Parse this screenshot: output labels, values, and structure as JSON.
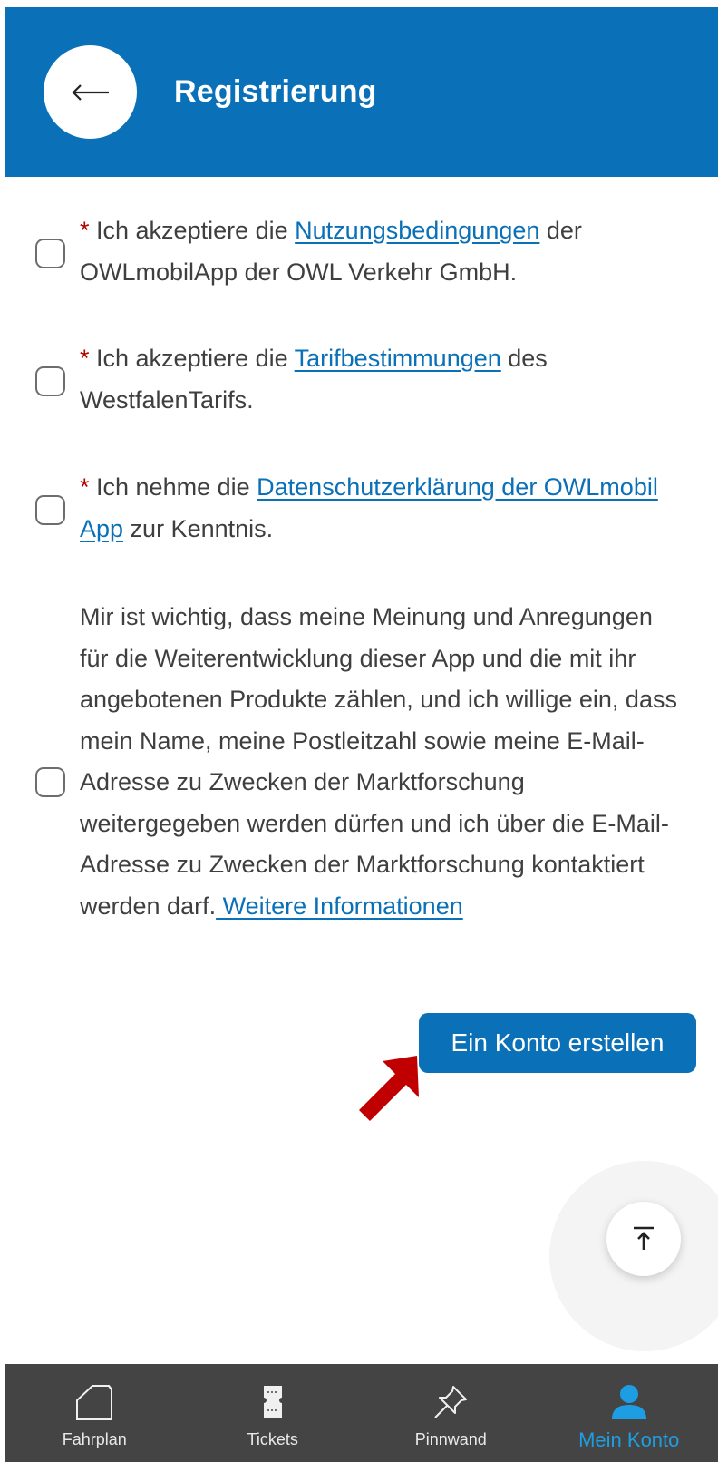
{
  "header": {
    "title": "Registrierung",
    "back_icon": "arrow-left-icon"
  },
  "consents": [
    {
      "required_mark": "*",
      "text_before": " Ich akzeptiere die ",
      "link_text": "Nutzungsbedingungen",
      "text_after": " der OWLmobilApp der OWL Verkehr GmbH.",
      "checked": false
    },
    {
      "required_mark": "*",
      "text_before": " Ich akzeptiere die ",
      "link_text": "Tarifbestimmungen",
      "text_after": " des WestfalenTarifs.",
      "checked": false
    },
    {
      "required_mark": "*",
      "text_before": " Ich nehme die ",
      "link_text": "Datenschutzerklärung der OWLmobil App",
      "text_after": " zur Kenntnis.",
      "checked": false
    },
    {
      "text_before": "Mir ist wichtig, dass meine Meinung und Anregungen für die Weiterentwicklung dieser App und die mit ihr angebotenen Produkte zählen, und ich willige ein, dass mein Name, meine Postleitzahl sowie meine E-Mail-Adresse zu Zwecken der Marktforschung weitergegeben werden dürfen und ich über die E-Mail-Adresse zu Zwecken der Marktforschung kontaktiert werden darf.",
      "link_text": " Weitere Informationen",
      "checked": false
    }
  ],
  "create_button": {
    "label": "Ein Konto erstellen"
  },
  "scroll_top": {
    "icon": "arrow-up-to-top-icon"
  },
  "bottom_nav": {
    "items": [
      {
        "label": "Fahrplan",
        "icon": "home-outline-icon",
        "active": false
      },
      {
        "label": "Tickets",
        "icon": "ticket-icon",
        "active": false
      },
      {
        "label": "Pinnwand",
        "icon": "pushpin-icon",
        "active": false
      },
      {
        "label": "Mein Konto",
        "icon": "user-icon",
        "active": true
      }
    ]
  },
  "colors": {
    "primary": "#0a70b8",
    "nav_background": "#444444",
    "nav_active": "#1e9ee2",
    "required": "#b10000",
    "annotation_arrow": "#c00000"
  }
}
